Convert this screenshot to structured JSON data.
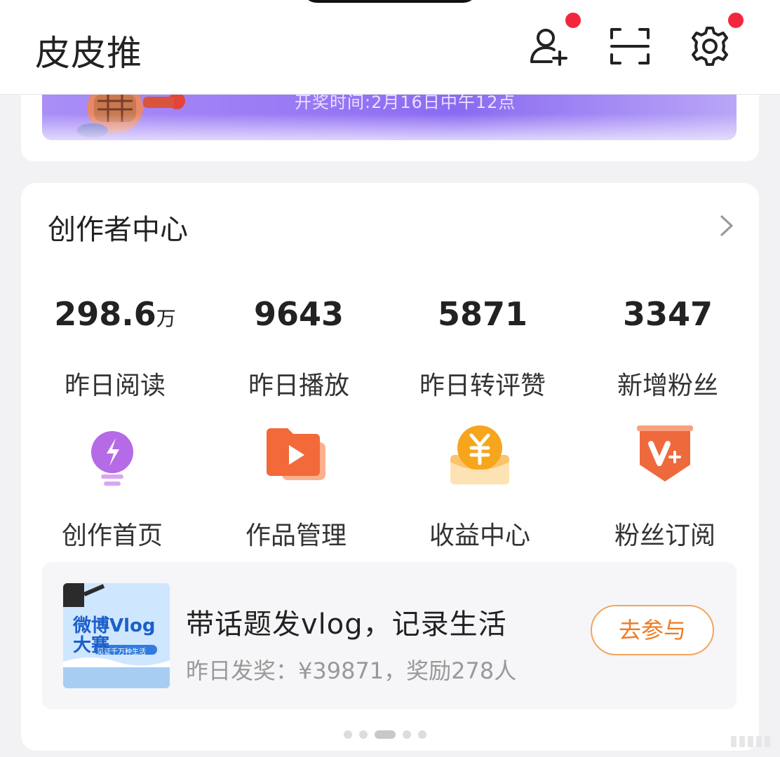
{
  "header": {
    "title": "皮皮推",
    "icons": [
      "add-user-icon",
      "scan-icon",
      "settings-icon"
    ],
    "notification_color": "#f3273c"
  },
  "banner": {
    "text": "开奖时间:2月16日中午12点"
  },
  "creator_center": {
    "title": "创作者中心",
    "stats": [
      {
        "value": "298.6",
        "unit": "万",
        "label": "昨日阅读"
      },
      {
        "value": "9643",
        "unit": "",
        "label": "昨日播放"
      },
      {
        "value": "5871",
        "unit": "",
        "label": "昨日转评赞"
      },
      {
        "value": "3347",
        "unit": "",
        "label": "新增粉丝"
      }
    ],
    "tools": [
      {
        "label": "创作首页",
        "icon": "lightbulb-icon"
      },
      {
        "label": "作品管理",
        "icon": "video-folder-icon"
      },
      {
        "label": "收益中心",
        "icon": "yuan-coin-icon"
      },
      {
        "label": "粉丝订阅",
        "icon": "v-plus-badge-icon"
      }
    ],
    "promo": {
      "title": "带话题发vlog，记录生活",
      "subtitle": "昨日发奖：¥39871，奖励278人",
      "button": "去参与",
      "thumb_line1": "微博Vlog",
      "thumb_line2": "大赛",
      "thumb_tag": "见证千万种生活"
    },
    "carousel": {
      "count": 5,
      "active_index": 2
    }
  },
  "colors": {
    "accent_orange": "#f07a20",
    "banner_purple": "#9b7af5"
  }
}
